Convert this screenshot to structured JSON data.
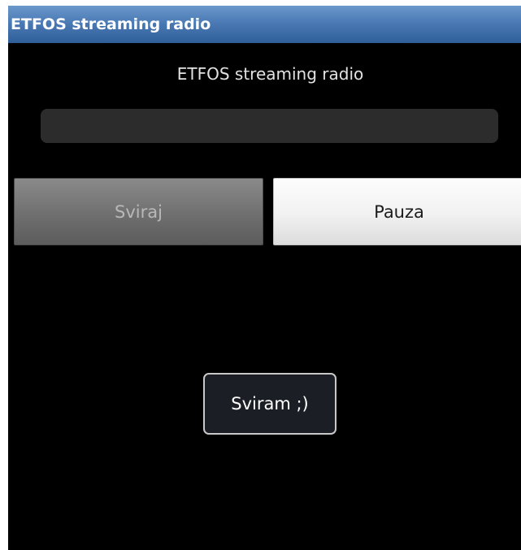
{
  "window": {
    "title": "ETFOS streaming radio"
  },
  "main": {
    "heading": "ETFOS streaming radio",
    "progress": {
      "value": 0
    },
    "buttons": {
      "play_label": "Sviraj",
      "pause_label": "Pauza"
    }
  },
  "toast": {
    "message": "Sviram ;)"
  },
  "colors": {
    "titlebar": "#4877b2",
    "background": "#000000"
  }
}
